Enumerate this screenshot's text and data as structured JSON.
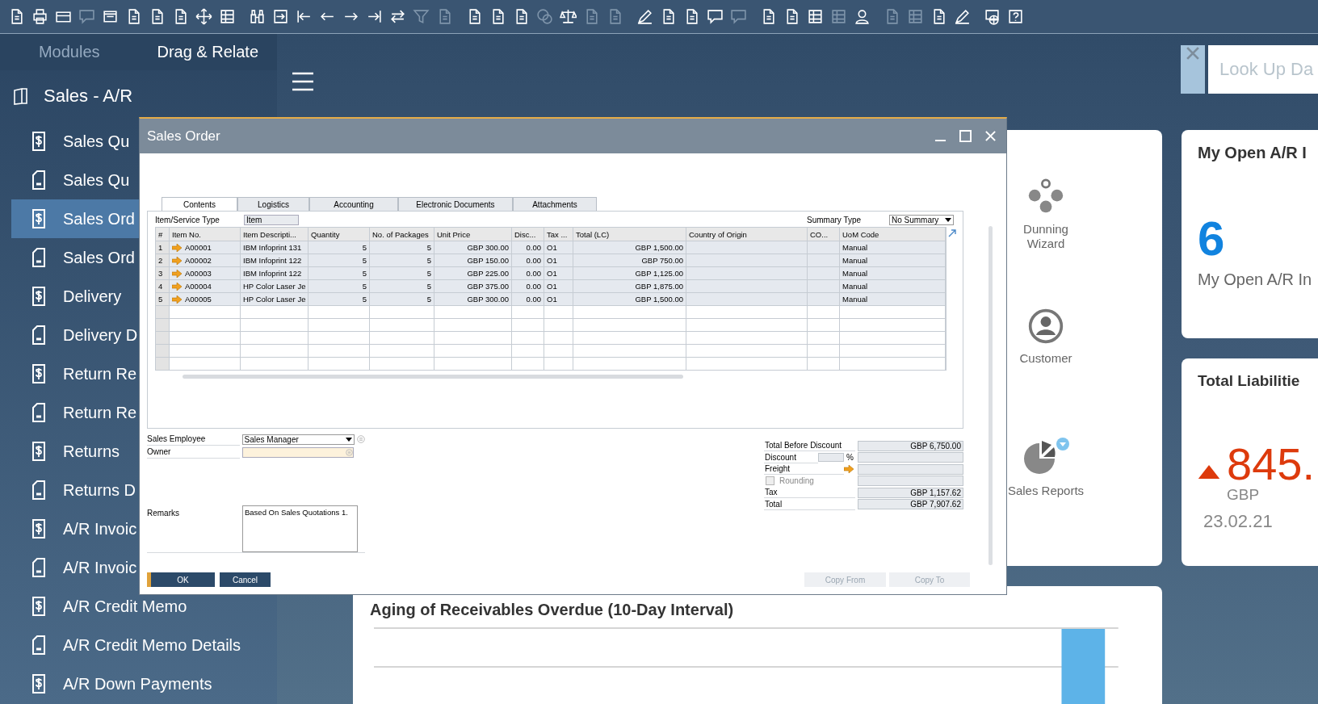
{
  "toolbar": [
    {
      "disabled": false
    },
    {
      "disabled": false
    },
    {
      "disabled": false
    },
    {
      "disabled": true
    },
    {
      "disabled": false
    },
    {
      "disabled": false
    },
    {
      "disabled": false
    },
    {
      "disabled": false
    },
    {
      "disabled": false
    },
    {
      "disabled": false
    },
    {
      "disabled": false
    },
    {
      "disabled": false
    },
    {
      "disabled": false
    },
    {
      "disabled": false
    },
    {
      "disabled": false
    },
    {
      "disabled": false
    },
    {
      "disabled": false
    },
    {
      "disabled": true
    },
    {
      "disabled": true
    },
    {
      "disabled": false
    },
    {
      "disabled": false
    },
    {
      "disabled": false
    },
    {
      "disabled": true
    },
    {
      "disabled": false
    },
    {
      "disabled": true
    },
    {
      "disabled": true
    },
    {
      "disabled": false
    },
    {
      "disabled": false
    },
    {
      "disabled": false
    },
    {
      "disabled": false
    },
    {
      "disabled": true
    },
    {
      "disabled": false
    },
    {
      "disabled": false
    },
    {
      "disabled": false
    },
    {
      "disabled": true
    },
    {
      "disabled": false
    },
    {
      "disabled": true
    },
    {
      "disabled": true
    },
    {
      "disabled": false
    },
    {
      "disabled": false
    },
    {
      "disabled": false
    },
    {
      "disabled": false
    }
  ],
  "nav_tabs": [
    {
      "label": "Modules",
      "selected": false
    },
    {
      "label": "Drag & Relate",
      "selected": true
    }
  ],
  "module": {
    "title": "Sales - A/R"
  },
  "menu_items": [
    {
      "label": "Sales Qu",
      "kind": "dollar",
      "selected": false
    },
    {
      "label": "Sales Qu",
      "kind": "report",
      "selected": false
    },
    {
      "label": "Sales Ord",
      "kind": "dollar",
      "selected": true
    },
    {
      "label": "Sales Ord",
      "kind": "report",
      "selected": false
    },
    {
      "label": "Delivery",
      "kind": "dollar",
      "selected": false
    },
    {
      "label": "Delivery D",
      "kind": "report",
      "selected": false
    },
    {
      "label": "Return Re",
      "kind": "dollar",
      "selected": false
    },
    {
      "label": "Return Re",
      "kind": "report",
      "selected": false
    },
    {
      "label": "Returns",
      "kind": "dollar",
      "selected": false
    },
    {
      "label": "Returns D",
      "kind": "report",
      "selected": false
    },
    {
      "label": "A/R Invoic",
      "kind": "dollar",
      "selected": false
    },
    {
      "label": "A/R Invoic",
      "kind": "report",
      "selected": false
    },
    {
      "label": "A/R Credit Memo",
      "kind": "dollar",
      "selected": false
    },
    {
      "label": "A/R Credit Memo Details",
      "kind": "report",
      "selected": false
    },
    {
      "label": "A/R Down Payments",
      "kind": "dollar",
      "selected": false
    }
  ],
  "lookup": {
    "placeholder": "Look Up Da"
  },
  "dialog": {
    "title": "Sales Order",
    "tabs": [
      {
        "label": "Contents",
        "selected": true
      },
      {
        "label": "Logistics",
        "selected": false
      },
      {
        "label": "Accounting",
        "selected": false
      },
      {
        "label": "Electronic Documents",
        "selected": false
      },
      {
        "label": "Attachments",
        "selected": false
      }
    ],
    "item_service_type": {
      "label": "Item/Service Type",
      "value": "Item"
    },
    "summary_type": {
      "label": "Summary Type",
      "value": "No Summary"
    },
    "columns": [
      "#",
      "Item No.",
      "Item Descripti...",
      "Quantity",
      "No. of Packages",
      "Unit Price",
      "Disc...",
      "Tax ...",
      "Total (LC)",
      "Country of Origin",
      "CO...",
      "UoM Code"
    ],
    "rows": [
      {
        "num": "1",
        "item_no": "A00001",
        "description": "IBM Infoprint 131",
        "quantity": "5",
        "packages": "5",
        "unit_price": "GBP 300.00",
        "discount": "0.00",
        "tax": "O1",
        "total": "GBP 1,500.00",
        "uom": "Manual"
      },
      {
        "num": "2",
        "item_no": "A00002",
        "description": "IBM Infoprint 122",
        "quantity": "5",
        "packages": "5",
        "unit_price": "GBP 150.00",
        "discount": "0.00",
        "tax": "O1",
        "total": "GBP 750.00",
        "uom": "Manual"
      },
      {
        "num": "3",
        "item_no": "A00003",
        "description": "IBM Infoprint 122",
        "quantity": "5",
        "packages": "5",
        "unit_price": "GBP 225.00",
        "discount": "0.00",
        "tax": "O1",
        "total": "GBP 1,125.00",
        "uom": "Manual"
      },
      {
        "num": "4",
        "item_no": "A00004",
        "description": "HP Color Laser Je",
        "quantity": "5",
        "packages": "5",
        "unit_price": "GBP 375.00",
        "discount": "0.00",
        "tax": "O1",
        "total": "GBP 1,875.00",
        "uom": "Manual"
      },
      {
        "num": "5",
        "item_no": "A00005",
        "description": "HP Color Laser Je",
        "quantity": "5",
        "packages": "5",
        "unit_price": "GBP 300.00",
        "discount": "0.00",
        "tax": "O1",
        "total": "GBP 1,500.00",
        "uom": "Manual"
      }
    ],
    "sales_employee": {
      "label": "Sales Employee",
      "value": "Sales Manager"
    },
    "owner": {
      "label": "Owner"
    },
    "remarks": {
      "label": "Remarks",
      "value": "Based On Sales Quotations 1."
    },
    "totals": [
      {
        "kind": "value",
        "label": "Total Before Discount",
        "value": "GBP 6,750.00"
      },
      {
        "kind": "percent",
        "label": "Discount",
        "symbol": "%"
      },
      {
        "kind": "link",
        "label": "Freight"
      },
      {
        "kind": "checkbox",
        "label": "Rounding",
        "checked": false
      },
      {
        "kind": "value",
        "label": "Tax",
        "value": "GBP 1,157.62"
      },
      {
        "kind": "value",
        "label": "Total",
        "value": "GBP 7,907.62"
      }
    ],
    "buttons": [
      {
        "label": "OK",
        "disabled": false
      },
      {
        "label": "Cancel",
        "disabled": false
      },
      {
        "label": "Copy From",
        "disabled": true
      },
      {
        "label": "Copy To",
        "disabled": true
      }
    ]
  },
  "shortcuts": [
    {
      "label": "Dunning Wizard",
      "kind": "dots"
    },
    {
      "label": "Customer",
      "kind": "person"
    },
    {
      "label": "Sales Reports",
      "kind": "pie"
    }
  ],
  "kpis": [
    {
      "kind": "count",
      "title": "My Open A/R I",
      "value": "6",
      "caption": "My Open A/R In"
    },
    {
      "kind": "trend",
      "title": "Total Liabilitie",
      "value": "845.",
      "unit": "GBP",
      "date": "23.02.21"
    }
  ],
  "aging_card": {
    "title": "Aging of Receivables Overdue (10-Day Interval)"
  }
}
